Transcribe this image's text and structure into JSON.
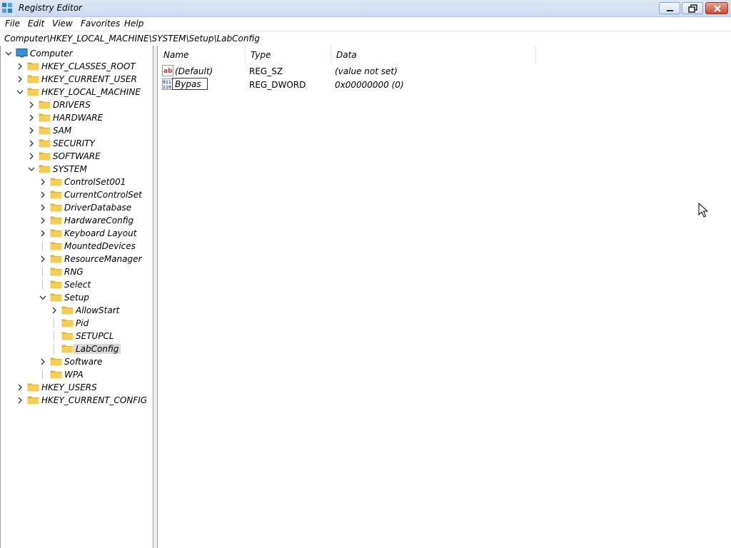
{
  "window": {
    "title": "Registry Editor"
  },
  "menu": [
    "File",
    "Edit",
    "View",
    "Favorites",
    "Help"
  ],
  "address": "Computer\\HKEY_LOCAL_MACHINE\\SYSTEM\\Setup\\LabConfig",
  "tree": [
    {
      "label": "Computer",
      "depth": 0,
      "expander": "expanded",
      "icon": "computer-icon"
    },
    {
      "label": "HKEY_CLASSES_ROOT",
      "depth": 1,
      "expander": "collapsed"
    },
    {
      "label": "HKEY_CURRENT_USER",
      "depth": 1,
      "expander": "collapsed"
    },
    {
      "label": "HKEY_LOCAL_MACHINE",
      "depth": 1,
      "expander": "expanded"
    },
    {
      "label": "DRIVERS",
      "depth": 2,
      "expander": "collapsed"
    },
    {
      "label": "HARDWARE",
      "depth": 2,
      "expander": "collapsed"
    },
    {
      "label": "SAM",
      "depth": 2,
      "expander": "collapsed"
    },
    {
      "label": "SECURITY",
      "depth": 2,
      "expander": "collapsed"
    },
    {
      "label": "SOFTWARE",
      "depth": 2,
      "expander": "collapsed"
    },
    {
      "label": "SYSTEM",
      "depth": 2,
      "expander": "expanded"
    },
    {
      "label": "ControlSet001",
      "depth": 3,
      "expander": "collapsed"
    },
    {
      "label": "CurrentControlSet",
      "depth": 3,
      "expander": "collapsed"
    },
    {
      "label": "DriverDatabase",
      "depth": 3,
      "expander": "collapsed"
    },
    {
      "label": "HardwareConfig",
      "depth": 3,
      "expander": "collapsed"
    },
    {
      "label": "Keyboard Layout",
      "depth": 3,
      "expander": "collapsed"
    },
    {
      "label": "MountedDevices",
      "depth": 3,
      "expander": "none"
    },
    {
      "label": "ResourceManager",
      "depth": 3,
      "expander": "collapsed"
    },
    {
      "label": "RNG",
      "depth": 3,
      "expander": "none"
    },
    {
      "label": "Select",
      "depth": 3,
      "expander": "none"
    },
    {
      "label": "Setup",
      "depth": 3,
      "expander": "expanded"
    },
    {
      "label": "AllowStart",
      "depth": 4,
      "expander": "collapsed"
    },
    {
      "label": "Pid",
      "depth": 4,
      "expander": "none"
    },
    {
      "label": "SETUPCL",
      "depth": 4,
      "expander": "none"
    },
    {
      "label": "LabConfig",
      "depth": 4,
      "expander": "none",
      "selected": true
    },
    {
      "label": "Software",
      "depth": 3,
      "expander": "collapsed"
    },
    {
      "label": "WPA",
      "depth": 3,
      "expander": "none"
    },
    {
      "label": "HKEY_USERS",
      "depth": 1,
      "expander": "collapsed"
    },
    {
      "label": "HKEY_CURRENT_CONFIG",
      "depth": 1,
      "expander": "collapsed"
    }
  ],
  "columns": [
    "Name",
    "Type",
    "Data"
  ],
  "values": [
    {
      "name": "(Default)",
      "type": "REG_SZ",
      "data": "(value not set)",
      "icon": "string-value-icon"
    },
    {
      "name": "Bypas",
      "type": "REG_DWORD",
      "data": "0x00000000 (0)",
      "icon": "binary-value-icon",
      "renaming": true
    }
  ],
  "colors": {
    "folder": "#f5cf55",
    "folder_dark": "#e0b23a",
    "selection": "#d9d9d9",
    "computer": "#3a8fd9"
  }
}
